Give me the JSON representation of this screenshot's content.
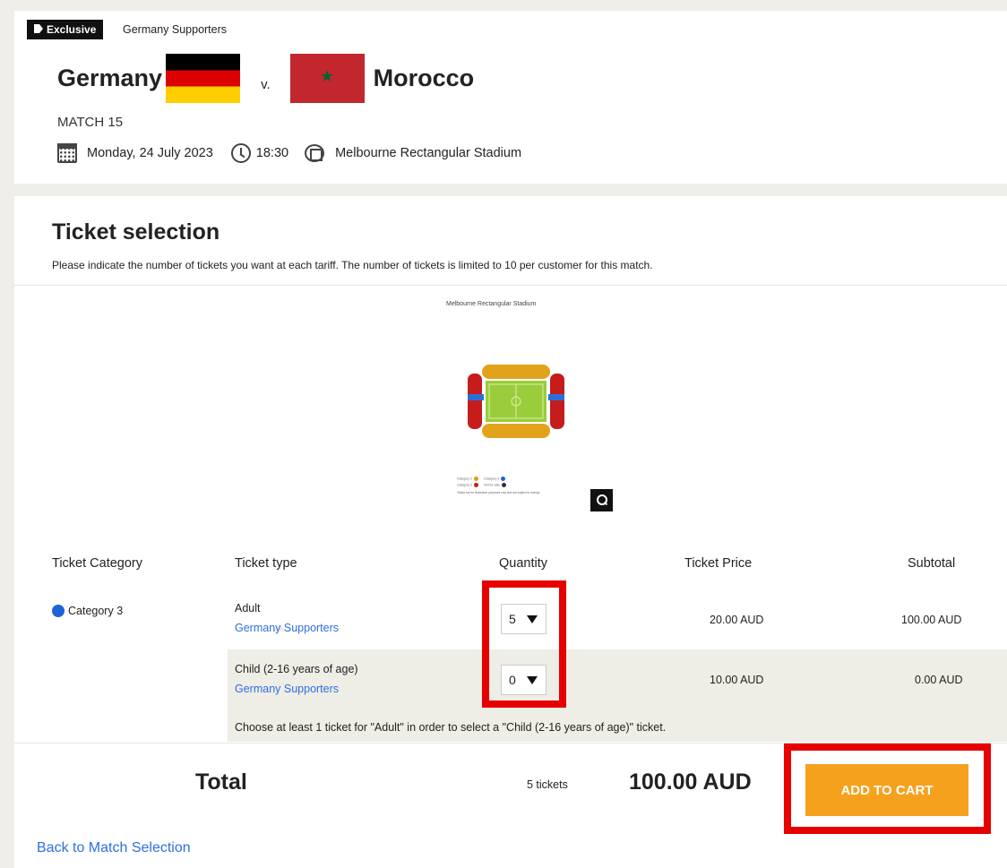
{
  "match": {
    "badge": "Exclusive",
    "badge_subtitle": "Germany Supporters",
    "home_team": "Germany",
    "vs": "v.",
    "away_team": "Morocco",
    "match_number": "MATCH 15",
    "date": "Monday, 24 July 2023",
    "time": "18:30",
    "venue": "Melbourne Rectangular Stadium"
  },
  "ticket_selection": {
    "title": "Ticket selection",
    "description": "Please indicate the number of tickets you want at each tariff. The number of tickets is limited to 10 per customer for this match.",
    "map_title": "Melbourne Rectangular Stadium",
    "legend": [
      {
        "label": "Category 1",
        "color": "#e39a1b"
      },
      {
        "label": "Category 3",
        "color": "#1e63d6"
      },
      {
        "label": "Category 2",
        "color": "#c91a1a"
      },
      {
        "label": "Not for sale",
        "color": "#333333"
      }
    ],
    "legend_note": "*Maps are for illustrative purposes only and are subject to change"
  },
  "table": {
    "headers": {
      "category": "Ticket Category",
      "type": "Ticket type",
      "quantity": "Quantity",
      "price": "Ticket Price",
      "subtotal": "Subtotal"
    },
    "category": "Category 3",
    "category_color": "#1e63d6",
    "rows": [
      {
        "type": "Adult",
        "group": "Germany Supporters",
        "quantity": "5",
        "price": "20.00 AUD",
        "subtotal": "100.00 AUD"
      },
      {
        "type": "Child (2-16 years of age)",
        "group": "Germany Supporters",
        "quantity": "0",
        "price": "10.00 AUD",
        "subtotal": "0.00 AUD"
      }
    ],
    "notice": "Choose at least 1 ticket for \"Adult\" in order to select a \"Child (2-16 years of age)\" ticket."
  },
  "totals": {
    "label": "Total",
    "count": "5 tickets",
    "amount": "100.00 AUD",
    "cta": "ADD TO CART"
  },
  "back_link": "Back to Match Selection",
  "colors": {
    "accent_orange": "#f6a11d",
    "link_blue": "#2f6ee0",
    "highlight_red": "#e60000"
  }
}
